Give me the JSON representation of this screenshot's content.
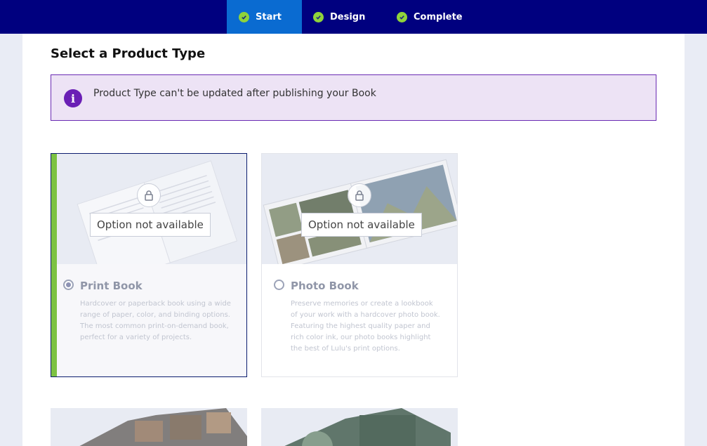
{
  "stepper": {
    "steps": [
      {
        "label": "Start",
        "active": true
      },
      {
        "label": "Design",
        "active": false
      },
      {
        "label": "Complete",
        "active": false
      }
    ],
    "check_color": "#8fd33b"
  },
  "page": {
    "title": "Select a Product Type"
  },
  "notice": {
    "message": "Product Type can't be updated after publishing your Book"
  },
  "products": [
    {
      "name": "Print Book",
      "selected": true,
      "status": "Option not available",
      "description": "Hardcover or paperback book using a wide range of paper, color, and binding options. The most common print-on-demand book, perfect for a variety of projects."
    },
    {
      "name": "Photo Book",
      "selected": false,
      "status": "Option not available",
      "description": "Preserve memories or create a lookbook of your work with a hardcover photo book. Featuring the highest quality paper and rich color ink, our photo books highlight the best of Lulu's print options."
    }
  ],
  "colors": {
    "nav_bg": "#00007f",
    "active_step_bg": "#0a6bd1",
    "selected_accent": "#7cc242",
    "info_icon": "#6a1fb5"
  }
}
